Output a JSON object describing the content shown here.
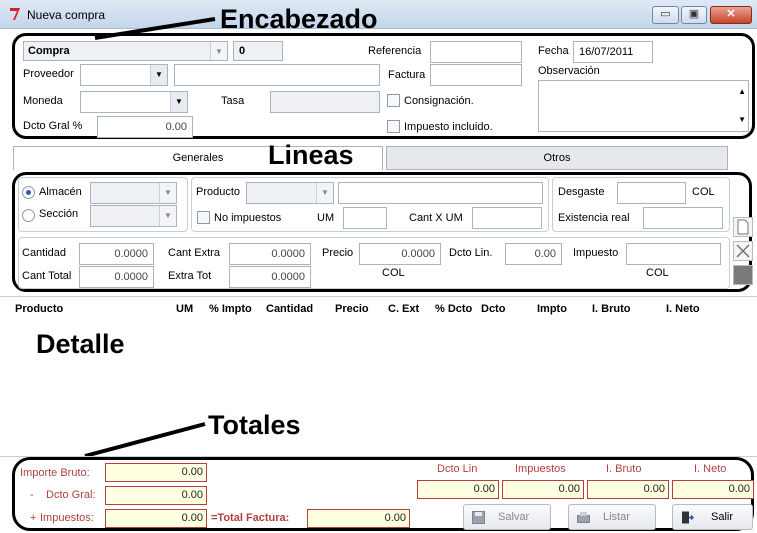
{
  "window": {
    "title": "Nueva compra",
    "minimize": "▭",
    "maximize": "▣",
    "close": "✕"
  },
  "annotations": {
    "encabezado": "Encabezado",
    "lineas": "Lineas",
    "detalle": "Detalle",
    "totales": "Totales"
  },
  "header": {
    "doc_type": "Compra",
    "doc_number": "0",
    "referencia_label": "Referencia",
    "referencia_value": "",
    "fecha_label": "Fecha",
    "fecha_value": "16/07/2011",
    "proveedor_label": "Proveedor",
    "factura_label": "Factura",
    "observacion_label": "Observación",
    "moneda_label": "Moneda",
    "tasa_label": "Tasa",
    "consignacion_label": "Consignación.",
    "dcto_gral_label": "Dcto Gral  %",
    "dcto_gral_value": "0.00",
    "impuesto_incluido_label": "Impuesto incluido."
  },
  "tabs": [
    {
      "label": "Generales",
      "active": true
    },
    {
      "label": "Otros",
      "active": false
    }
  ],
  "lines": {
    "almacen_label": "Almacén",
    "seccion_label": "Sección",
    "producto_label": "Producto",
    "no_impuestos_label": "No impuestos",
    "um_label": "UM",
    "cant_x_um_label": "Cant X UM",
    "desgaste_label": "Desgaste",
    "desgaste_currency": "COL",
    "existencia_label": "Existencia real",
    "cantidad_label": "Cantidad",
    "cantidad_value": "0.0000",
    "cant_total_label": "Cant Total",
    "cant_total_value": "0.0000",
    "cant_extra_label": "Cant Extra",
    "cant_extra_value": "0.0000",
    "extra_tot_label": "Extra Tot",
    "extra_tot_value": "0.0000",
    "precio_label": "Precio",
    "precio_value": "0.0000",
    "precio_currency": "COL",
    "dcto_lin_label": "Dcto Lin.",
    "dcto_lin_value": "0.00",
    "impuesto_label": "Impuesto",
    "impuesto_currency": "COL"
  },
  "detail": {
    "columns": [
      "Producto",
      "UM",
      "% Impto",
      "Cantidad",
      "Precio",
      "C. Ext",
      "% Dcto",
      "Dcto",
      "Impto",
      "I. Bruto",
      "I. Neto"
    ]
  },
  "totals": {
    "importe_bruto_label": "Importe Bruto:",
    "importe_bruto_value": "0.00",
    "dcto_gral_prefix": "-",
    "dcto_gral_label": "Dcto Gral:",
    "dcto_gral_value": "0.00",
    "impuestos_prefix": "+",
    "impuestos_label": "Impuestos:",
    "impuestos_value": "0.00",
    "total_factura_label": "=Total Factura:",
    "total_factura_value": "0.00",
    "summary_headers": [
      "Dcto Lin",
      "Impuestos",
      "I. Bruto",
      "I. Neto"
    ],
    "summary_values": [
      "0.00",
      "0.00",
      "0.00",
      "0.00"
    ]
  },
  "buttons": {
    "salvar": "Salvar",
    "listar": "Listar",
    "salir": "Salir"
  }
}
